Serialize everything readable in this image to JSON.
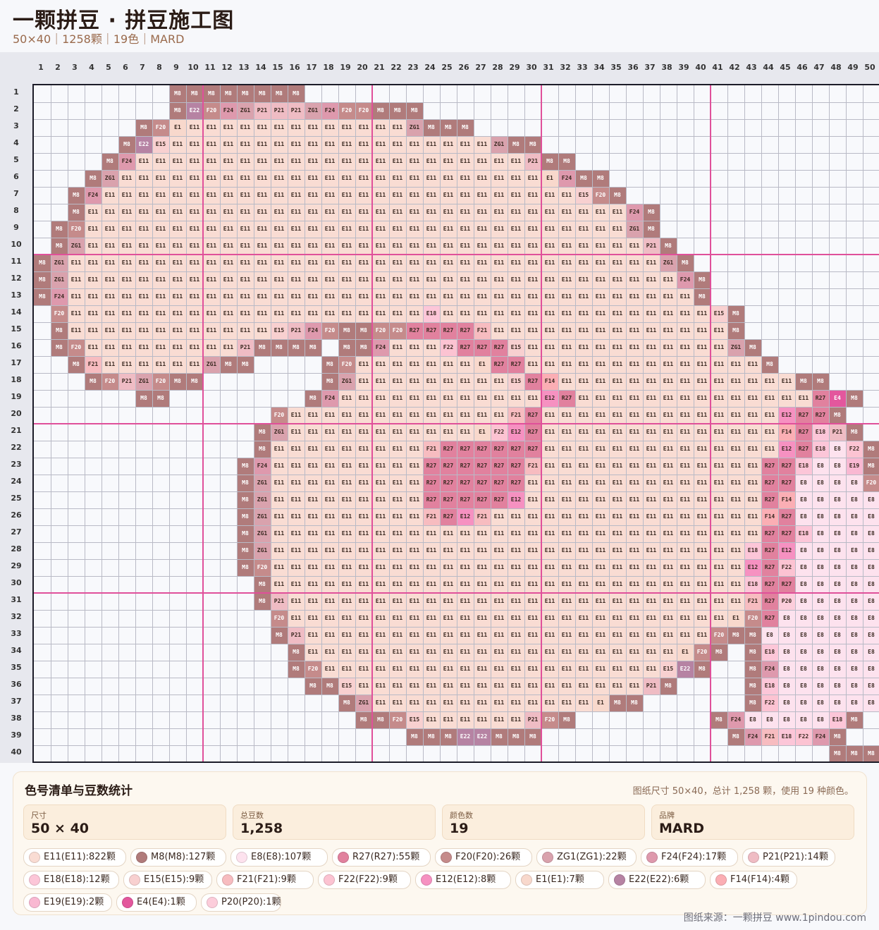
{
  "header": {
    "title": "一颗拼豆 · 拼豆施工图",
    "subtitle": "50×40｜1258颗｜19色｜MARD"
  },
  "grid": {
    "cols": 50,
    "rows": 40,
    "row_data": [
      "........M8|M8|M8|M8|M8|M8|M8|M8..........................",
      "........M8|E22|F20|F24|ZG1|P21|P21|P21|ZG1|F24|F20|F20|M8|M8|M8........................",
      "......M8|F20|E1|E11|E11|E11|E11|E11|E11|E11|E11|E11|E11|E11|E11|E11|ZG1|M8|M8|M8.....................",
      ".....M8|E22|E15|E11|E11|E11|E11|E11|E11|E11|E11|E11|E11|E11|E11|E11|E11|E11|E11|E11|E11|E11|ZG1|M8|M8....................",
      "....M8|F24|E11|E11|E11|E11|E11|E11|E11|E11|E11|E11|E11|E11|E11|E11|E11|E11|E11|E11|E11|E11|E11|E11|E11|P21|M8|M8...................",
      "...M8|ZG1|E11|E11|E11|E11|E11|E11|E11|E11|E11|E11|E11|E11|E11|E11|E11|E11|E11|E11|E11|E11|E11|E11|E11|E11|E11|E1|F24|M8|M8..................",
      "..M8|F24|E11|E11|E11|E11|E11|E11|E11|E11|E11|E11|E11|E11|E11|E11|E11|E11|E11|E11|E11|E11|E11|E11|E11|E11|E11|E11|E11|E11|E15|F20|M8................",
      "..M8|E11|E11|E11|E11|E11|E11|E11|E11|E11|E11|E11|E11|E11|E11|E11|E11|E11|E11|E11|E11|E11|E11|E11|E11|E11|E11|E11|E11|E11|E11|E11|E11|F24|M8...............",
      ".M8|F20|E11|E11|E11|E11|E11|E11|E11|E11|E11|E11|E11|E11|E11|E11|E11|E11|E11|E11|E11|E11|E11|E11|E11|E11|E11|E11|E11|E11|E11|E11|E11|E11|ZG1|M8..............",
      ".M8|ZG1|E11|E11|E11|E11|E11|E11|E11|E11|E11|E11|E11|E11|E11|E11|E11|E11|E11|E11|E11|E11|E11|E11|E11|E11|E11|E11|E11|E11|E11|E11|E11|E11|E11|P21|M8.............",
      "M8|ZG1|E11|E11|E11|E11|E11|E11|E11|E11|E11|E11|E11|E11|E11|E11|E11|E11|E11|E11|E11|E11|E11|E11|E11|E11|E11|E11|E11|E11|E11|E11|E11|E11|E11|E11|E11|ZG1|M8............",
      "M8|ZG1|E11|E11|E11|E11|E11|E11|E11|E11|E11|E11|E11|E11|E11|E11|E11|E11|E11|E11|E11|E11|E11|E11|E11|E11|E11|E11|E11|E11|E11|E11|E11|E11|E11|E11|E11|E11|F24|M8...........",
      "M8|F24|E11|E11|E11|E11|E11|E11|E11|E11|E11|E11|E11|E11|E11|E11|E11|E11|E11|E11|E11|E11|E11|E11|E11|E11|E11|E11|E11|E11|E11|E11|E11|E11|E11|E11|E11|E11|E11|M8...........",
      ".F20|E11|E11|E11|E11|E11|E11|E11|E11|E11|E11|E11|E11|E11|E11|E11|E11|E11|E11|E11|E11|E11|E18|E11|E11|E11|E11|E11|E11|E11|E11|E11|E11|E11|E11|E11|E11|E11|E11|E15|M8..........",
      ".M8|E11|E11|E11|E11|E11|E11|E11|E11|E11|E11|E11|E11|E15|P21|F24|F20|M8|M8|F20|F20|R27|R27|R27|R27|F21|E11|E11|E11|E11|E11|E11|E11|E11|E11|E11|E11|E11|E11|E11|M8..........",
      ".M8|F20|E11|E11|E11|E11|E11|E11|E11|E11|E11|P21|M8|M8|M8|M8|.|M8|M8|F24|E11|E11|E11|F22|R27|R27|R27|E15|E11|E11|E11|E11|E11|E11|E11|E11|E11|E11|E11|E11|ZG1|M8.........",
      "..M8|F21|E11|E11|E11|E11|E11|E11|ZG1|M8|M8|.|.|.|.|M8|F20|E11|E11|E11|E11|E11|E11|E11|E1|R27|R27|E11|E11|E11|E11|E11|E11|E11|E11|E11|E11|E11|E11|E11|E11|M8.........",
      "...M8|F20|P21|ZG1|F20|M8|M8|.|.|.|.|.|.|.|M8|ZG1|E11|E11|E11|E11|E11|E11|E11|E11|E11|E15|R27|F14|E11|E11|E11|E11|E11|E11|E11|E11|E11|E11|E11|E11|E11|E11|M8|M8........",
      "......M8|M8|.|.|.|.|.|.|.|.|M8|F24|E11|E11|E11|E11|E11|E11|E11|E11|E11|E11|E11|E11|E12|R27|E11|E11|E11|E11|E11|E11|E11|E11|E11|E11|E11|E11|E11|E11|R27|E4|M8.......",
      "..............F20|E11|E11|E11|E11|E11|E11|E11|E11|E11|E11|E11|E11|E11|F21|R27|E11|E11|E11|E11|E11|E11|E11|E11|E11|E11|E11|E11|E11|E11|E12|R27|R27|M8.......",
      ".............M8|ZG1|E11|E11|E11|E11|E11|E11|E11|E11|E11|E11|E11|E1|F22|E12|R27|E11|E11|E11|E11|E11|E11|E11|E11|E11|E11|E11|E11|E11|E11|F14|R27|E18|P21|M8......",
      ".............M8|E11|E11|E11|E11|E11|E11|E11|E11|E11|F21|R27|R27|R27|R27|R27|R27|E11|E11|E11|E11|E11|E11|E11|E11|E11|E11|E11|E11|E11|E11|E12|R27|E18|E8|F22|M8.....",
      "............M8|F24|E11|E11|E11|E11|E11|E11|E11|E11|E11|R27|R27|R27|R27|R27|R27|F21|E11|E11|E11|E11|E11|E11|E11|E11|E11|E11|E11|E11|E11|R27|R27|E18|E8|E8|E19|M8....",
      "............M8|ZG1|E11|E11|E11|E11|E11|E11|E11|E11|E11|R27|R27|R27|R27|R27|R27|E11|E11|E11|E11|E11|E11|E11|E11|E11|E11|E11|E11|E11|E11|R27|R27|E8|E8|E8|E8|F20|M8...",
      "............M8|ZG1|E11|E11|E11|E11|E11|E11|E11|E11|E11|R27|R27|R27|R27|R27|E12|E11|E11|E11|E11|E11|E11|E11|E11|E11|E11|E11|E11|E11|E11|R27|F14|E8|E8|E8|E8|E8|M8...",
      "............M8|ZG1|E11|E11|E11|E11|E11|E11|E11|E11|E11|F21|R27|E12|F21|E11|E11|E11|E11|E11|E11|E11|E11|E11|E11|E11|E11|E11|E11|E11|E11|F14|R27|E8|E8|E8|E8|E8|E8|F20..",
      "............M8|ZG1|E11|E11|E11|E11|E11|E11|E11|E11|E11|E11|E11|E11|E11|E11|E11|E11|E11|E11|E11|E11|E11|E11|E11|E11|E11|E11|E11|E11|E11|R27|R27|E18|E8|E8|E8|E8|E8|F22|M8.",
      "............M8|ZG1|E11|E11|E11|E11|E11|E11|E11|E11|E11|E11|E11|E11|E11|E11|E11|E11|E11|E11|E11|E11|E11|E11|E11|E11|E11|E11|E11|E11|E18|R27|E12|E8|E8|E8|E8|E8|E8|E8|E22.",
      "............M8|F20|E11|E11|E11|E11|E11|E11|E11|E11|E11|E11|E11|E11|E11|E11|E11|E11|E11|E11|E11|E11|E11|E11|E11|E11|E11|E11|E11|E11|E12|R27|F22|E8|E8|E8|E8|E8|E8|E8|F20.",
      ".............M8|E11|E11|E11|E11|E11|E11|E11|E11|E11|E11|E11|E11|E11|E11|E11|E11|E11|E11|E11|E11|E11|E11|E11|E11|E11|E11|E11|E11|E18|R27|R27|E8|E8|E8|E8|E8|E8|E8|E8|ZG1|M8",
      ".............M8|P21|E11|E11|E11|E11|E11|E11|E11|E11|E11|E11|E11|E11|E11|E11|E11|E11|E11|E11|E11|E11|E11|E11|E11|E11|E11|E11|E11|F21|R27|P20|E8|E8|E8|E8|E8|E8|E8|E8|F22|M8",
      "..............F20|E11|E11|E11|E11|E11|E11|E11|E11|E11|E11|E11|E11|E11|E11|E11|E11|E11|E11|E11|E11|E11|E11|E11|E11|E11|E11|E1|F20|R27|E8|E8|E8|E8|E8|E8|E8|E8|E8|E8|M8",
      "..............M8|P21|E11|E11|E11|E11|E11|E11|E11|E11|E11|E11|E11|E11|E11|E11|E11|E11|E11|E11|E11|E11|E11|E11|E11|E11|F20|M8|M8|E8|E8|E8|E8|E8|E8|E8|E8|E8|E8|E8|M8",
      "...............M8|E11|E11|E11|E11|E11|E11|E11|E11|E11|E11|E11|E11|E11|E11|E11|E11|E11|E11|E11|E11|E11|E11|E1|F20|M8|.|M8|E18|E8|E8|E8|E8|E8|E8|E8|E8|E8|E8|M8",
      "...............M8|F20|E11|E11|E11|E11|E11|E11|E11|E11|E11|E11|E11|E11|E11|E11|E11|E11|E11|E11|E11|E11|E15|E22|M8|.|.|M8|F24|E8|E8|E8|E8|E8|E8|E8|E8|E8|F22|M8",
      "................M8|M8|E15|E11|E11|E11|E11|E11|E11|E11|E11|E11|E11|E11|E11|E11|E11|E11|E11|E11|P21|M8|.|.|.|.|M8|E18|E8|E8|E8|E8|E8|E8|E8|E8|F24.",
      "..................M8|ZG1|E11|E11|E11|E11|E11|E11|E11|E11|E11|E11|E11|E11|E11|E1|M8|M8|.|.|.|.|.|.|M8|F22|E8|E8|E8|E8|E8|E8|E18|M8.",
      "...................M8|M8|F20|E15|E11|E11|E11|E11|E11|E11|P21|F20|M8|.|.|.|.|.|.|.|.|M8|F24|E8|E8|E8|E8|E8|E18|M8..",
      "......................M8|M8|M8|E22|E22|M8|M8|M8|.|.|.|.|.|.|.|.|.|.|.|M8|F24|F21|E18|F22|F24|M8...",
      "...............................................M8|M8|M8|M8|M8....."
    ]
  },
  "colors": {
    "E11": "#f9dcd3",
    "M8": "#b07b7b",
    "E8": "#fde2ee",
    "R27": "#e1819e",
    "F20": "#c58b8b",
    "ZG1": "#d9a2ad",
    "F24": "#de99ad",
    "P21": "#efbcc4",
    "E18": "#fcc6d8",
    "E15": "#f8d0d0",
    "F21": "#f7bcc0",
    "F22": "#fcc3d2",
    "E12": "#f691c1",
    "E1": "#f8d8cc",
    "E22": "#b683a3",
    "F14": "#fbaeb4",
    "E19": "#f9b8d2",
    "E4": "#e3579d",
    "P20": "#fccddb"
  },
  "panel": {
    "title": "色号清单与豆数统计",
    "note": "图纸尺寸 50×40，总计 1,258 颗，使用 19 种颜色。",
    "stats": [
      {
        "label": "尺寸",
        "value": "50 × 40"
      },
      {
        "label": "总豆数",
        "value": "1,258"
      },
      {
        "label": "颜色数",
        "value": "19"
      },
      {
        "label": "品牌",
        "value": "MARD"
      }
    ],
    "chips": [
      {
        "code": "E11",
        "text": "E11(E11):822颗"
      },
      {
        "code": "M8",
        "text": "M8(M8):127颗"
      },
      {
        "code": "E8",
        "text": "E8(E8):107颗"
      },
      {
        "code": "R27",
        "text": "R27(R27):55颗"
      },
      {
        "code": "F20",
        "text": "F20(F20):26颗"
      },
      {
        "code": "ZG1",
        "text": "ZG1(ZG1):22颗"
      },
      {
        "code": "F24",
        "text": "F24(F24):17颗"
      },
      {
        "code": "P21",
        "text": "P21(P21):14颗"
      },
      {
        "code": "E18",
        "text": "E18(E18):12颗"
      },
      {
        "code": "E15",
        "text": "E15(E15):9颗"
      },
      {
        "code": "F21",
        "text": "F21(F21):9颗"
      },
      {
        "code": "F22",
        "text": "F22(F22):9颗"
      },
      {
        "code": "E12",
        "text": "E12(E12):8颗"
      },
      {
        "code": "E1",
        "text": "E1(E1):7颗"
      },
      {
        "code": "E22",
        "text": "E22(E22):6颗"
      },
      {
        "code": "F14",
        "text": "F14(F14):4颗"
      },
      {
        "code": "E19",
        "text": "E19(E19):2颗"
      },
      {
        "code": "E4",
        "text": "E4(E4):1颗"
      },
      {
        "code": "P20",
        "text": "P20(P20):1颗"
      }
    ]
  },
  "footer": {
    "source": "图纸来源：一颗拼豆 www.1pindou.com"
  }
}
